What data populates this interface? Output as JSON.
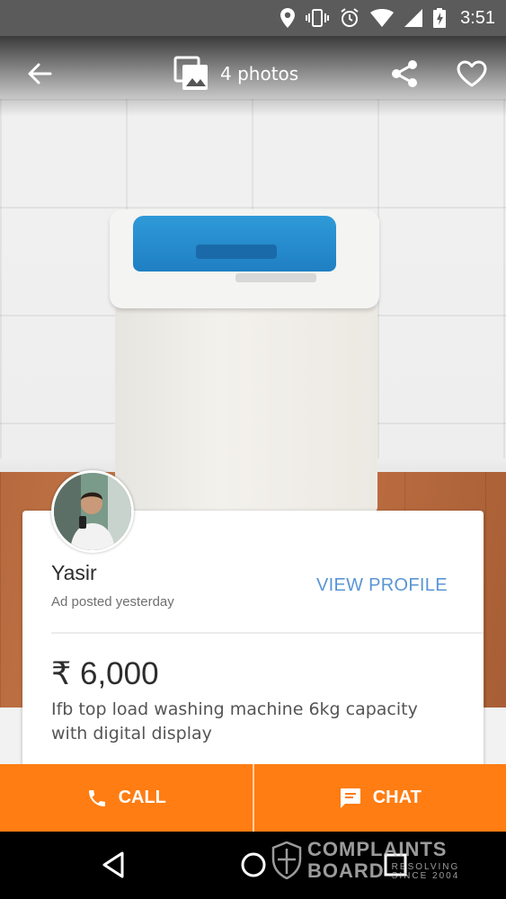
{
  "status_bar": {
    "time": "3:51"
  },
  "toolbar": {
    "photos_label": "4 photos"
  },
  "seller": {
    "name": "Yasir",
    "posted": "Ad posted yesterday",
    "view_profile": "VIEW PROFILE"
  },
  "listing": {
    "price": "₹ 6,000",
    "description": "Ifb top load washing machine 6kg capacity with digital display"
  },
  "actions": {
    "call": "CALL",
    "chat": "CHAT"
  },
  "watermark": {
    "line1": "COMPLAINTS",
    "line2": "BOARD",
    "tag1": "RESOLVING",
    "tag2": "SINCE 2004"
  },
  "colors": {
    "accent": "#ff7d12",
    "link": "#5a95d5",
    "lid": "#1f7fc3"
  }
}
